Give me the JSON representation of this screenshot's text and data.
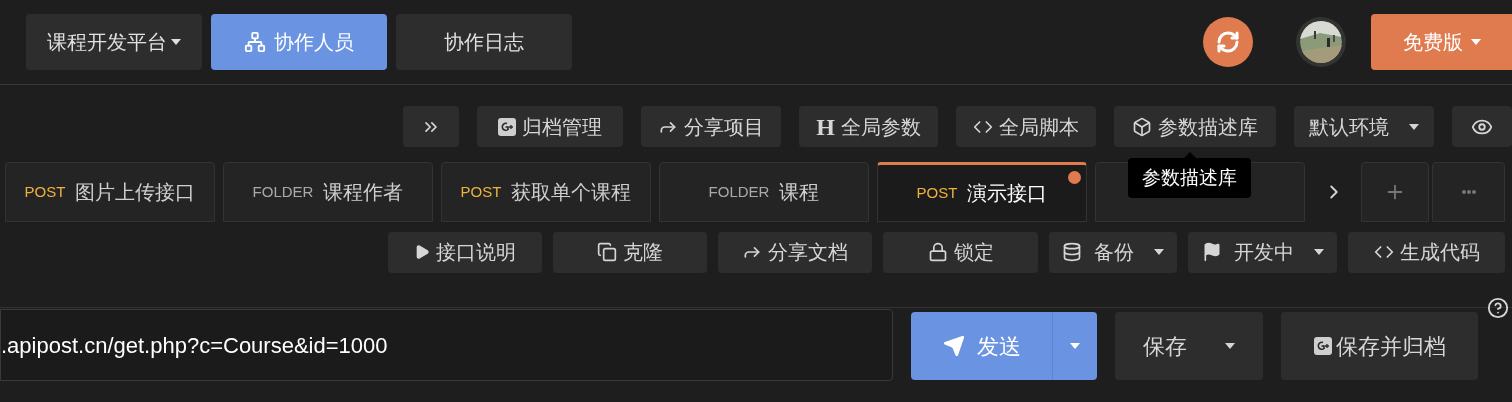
{
  "top_bar": {
    "project_menu": {
      "label": "课程开发平台"
    },
    "nav": [
      {
        "label": "协作人员",
        "selected": true
      },
      {
        "label": "协作日志",
        "selected": false
      }
    ],
    "plan_button": {
      "label": "免费版"
    }
  },
  "toolbar": [
    {
      "kind": "icon"
    },
    {
      "kind": "button",
      "label": "归档管理"
    },
    {
      "kind": "button",
      "label": "分享项目"
    },
    {
      "kind": "button",
      "label": "全局参数",
      "glyph": "H"
    },
    {
      "kind": "button",
      "label": "全局脚本"
    },
    {
      "kind": "button",
      "label": "参数描述库",
      "tooltip": "参数描述库"
    },
    {
      "kind": "dropdown",
      "label": "默认环境"
    },
    {
      "kind": "icon"
    }
  ],
  "tabs": [
    {
      "kind": "post",
      "method": "POST",
      "label": "图片上传接口",
      "selected": false,
      "unsaved": false
    },
    {
      "kind": "folder",
      "method": "FOLDER",
      "label": "课程作者",
      "selected": false,
      "unsaved": false
    },
    {
      "kind": "post",
      "method": "POST",
      "label": "获取单个课程",
      "selected": false,
      "unsaved": false
    },
    {
      "kind": "folder",
      "method": "FOLDER",
      "label": "课程",
      "selected": false,
      "unsaved": false
    },
    {
      "kind": "post",
      "method": "POST",
      "label": "演示接口",
      "selected": true,
      "unsaved": true
    },
    {
      "selected": false,
      "unsaved": false
    }
  ],
  "actions": [
    {
      "kind": "button",
      "label": "接口说明"
    },
    {
      "kind": "button",
      "label": "克隆"
    },
    {
      "kind": "button",
      "label": "分享文档"
    },
    {
      "kind": "button",
      "label": "锁定"
    },
    {
      "kind": "dropdown",
      "label": "备份"
    },
    {
      "kind": "dropdown",
      "label": "开发中"
    },
    {
      "kind": "button",
      "label": "生成代码"
    }
  ],
  "request": {
    "url": ".apipost.cn/get.php?c=Course&id=1000",
    "send_label": "发送",
    "save_label": "保存",
    "save_archive_label": "保存并归档"
  }
}
